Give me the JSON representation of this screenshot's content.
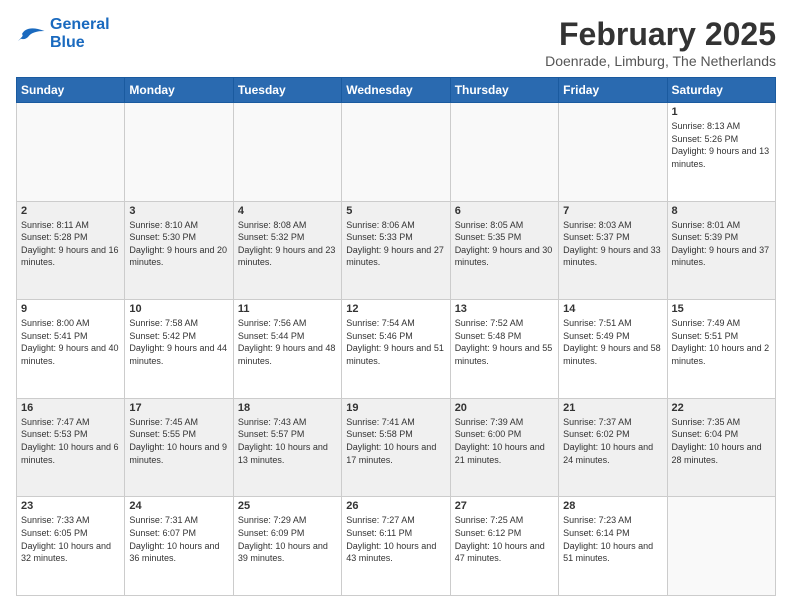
{
  "header": {
    "logo_line1": "General",
    "logo_line2": "Blue",
    "month_title": "February 2025",
    "subtitle": "Doenrade, Limburg, The Netherlands"
  },
  "days_of_week": [
    "Sunday",
    "Monday",
    "Tuesday",
    "Wednesday",
    "Thursday",
    "Friday",
    "Saturday"
  ],
  "weeks": [
    {
      "shaded": false,
      "days": [
        {
          "num": "",
          "info": ""
        },
        {
          "num": "",
          "info": ""
        },
        {
          "num": "",
          "info": ""
        },
        {
          "num": "",
          "info": ""
        },
        {
          "num": "",
          "info": ""
        },
        {
          "num": "",
          "info": ""
        },
        {
          "num": "1",
          "info": "Sunrise: 8:13 AM\nSunset: 5:26 PM\nDaylight: 9 hours and 13 minutes."
        }
      ]
    },
    {
      "shaded": true,
      "days": [
        {
          "num": "2",
          "info": "Sunrise: 8:11 AM\nSunset: 5:28 PM\nDaylight: 9 hours and 16 minutes."
        },
        {
          "num": "3",
          "info": "Sunrise: 8:10 AM\nSunset: 5:30 PM\nDaylight: 9 hours and 20 minutes."
        },
        {
          "num": "4",
          "info": "Sunrise: 8:08 AM\nSunset: 5:32 PM\nDaylight: 9 hours and 23 minutes."
        },
        {
          "num": "5",
          "info": "Sunrise: 8:06 AM\nSunset: 5:33 PM\nDaylight: 9 hours and 27 minutes."
        },
        {
          "num": "6",
          "info": "Sunrise: 8:05 AM\nSunset: 5:35 PM\nDaylight: 9 hours and 30 minutes."
        },
        {
          "num": "7",
          "info": "Sunrise: 8:03 AM\nSunset: 5:37 PM\nDaylight: 9 hours and 33 minutes."
        },
        {
          "num": "8",
          "info": "Sunrise: 8:01 AM\nSunset: 5:39 PM\nDaylight: 9 hours and 37 minutes."
        }
      ]
    },
    {
      "shaded": false,
      "days": [
        {
          "num": "9",
          "info": "Sunrise: 8:00 AM\nSunset: 5:41 PM\nDaylight: 9 hours and 40 minutes."
        },
        {
          "num": "10",
          "info": "Sunrise: 7:58 AM\nSunset: 5:42 PM\nDaylight: 9 hours and 44 minutes."
        },
        {
          "num": "11",
          "info": "Sunrise: 7:56 AM\nSunset: 5:44 PM\nDaylight: 9 hours and 48 minutes."
        },
        {
          "num": "12",
          "info": "Sunrise: 7:54 AM\nSunset: 5:46 PM\nDaylight: 9 hours and 51 minutes."
        },
        {
          "num": "13",
          "info": "Sunrise: 7:52 AM\nSunset: 5:48 PM\nDaylight: 9 hours and 55 minutes."
        },
        {
          "num": "14",
          "info": "Sunrise: 7:51 AM\nSunset: 5:49 PM\nDaylight: 9 hours and 58 minutes."
        },
        {
          "num": "15",
          "info": "Sunrise: 7:49 AM\nSunset: 5:51 PM\nDaylight: 10 hours and 2 minutes."
        }
      ]
    },
    {
      "shaded": true,
      "days": [
        {
          "num": "16",
          "info": "Sunrise: 7:47 AM\nSunset: 5:53 PM\nDaylight: 10 hours and 6 minutes."
        },
        {
          "num": "17",
          "info": "Sunrise: 7:45 AM\nSunset: 5:55 PM\nDaylight: 10 hours and 9 minutes."
        },
        {
          "num": "18",
          "info": "Sunrise: 7:43 AM\nSunset: 5:57 PM\nDaylight: 10 hours and 13 minutes."
        },
        {
          "num": "19",
          "info": "Sunrise: 7:41 AM\nSunset: 5:58 PM\nDaylight: 10 hours and 17 minutes."
        },
        {
          "num": "20",
          "info": "Sunrise: 7:39 AM\nSunset: 6:00 PM\nDaylight: 10 hours and 21 minutes."
        },
        {
          "num": "21",
          "info": "Sunrise: 7:37 AM\nSunset: 6:02 PM\nDaylight: 10 hours and 24 minutes."
        },
        {
          "num": "22",
          "info": "Sunrise: 7:35 AM\nSunset: 6:04 PM\nDaylight: 10 hours and 28 minutes."
        }
      ]
    },
    {
      "shaded": false,
      "days": [
        {
          "num": "23",
          "info": "Sunrise: 7:33 AM\nSunset: 6:05 PM\nDaylight: 10 hours and 32 minutes."
        },
        {
          "num": "24",
          "info": "Sunrise: 7:31 AM\nSunset: 6:07 PM\nDaylight: 10 hours and 36 minutes."
        },
        {
          "num": "25",
          "info": "Sunrise: 7:29 AM\nSunset: 6:09 PM\nDaylight: 10 hours and 39 minutes."
        },
        {
          "num": "26",
          "info": "Sunrise: 7:27 AM\nSunset: 6:11 PM\nDaylight: 10 hours and 43 minutes."
        },
        {
          "num": "27",
          "info": "Sunrise: 7:25 AM\nSunset: 6:12 PM\nDaylight: 10 hours and 47 minutes."
        },
        {
          "num": "28",
          "info": "Sunrise: 7:23 AM\nSunset: 6:14 PM\nDaylight: 10 hours and 51 minutes."
        },
        {
          "num": "",
          "info": ""
        }
      ]
    }
  ]
}
